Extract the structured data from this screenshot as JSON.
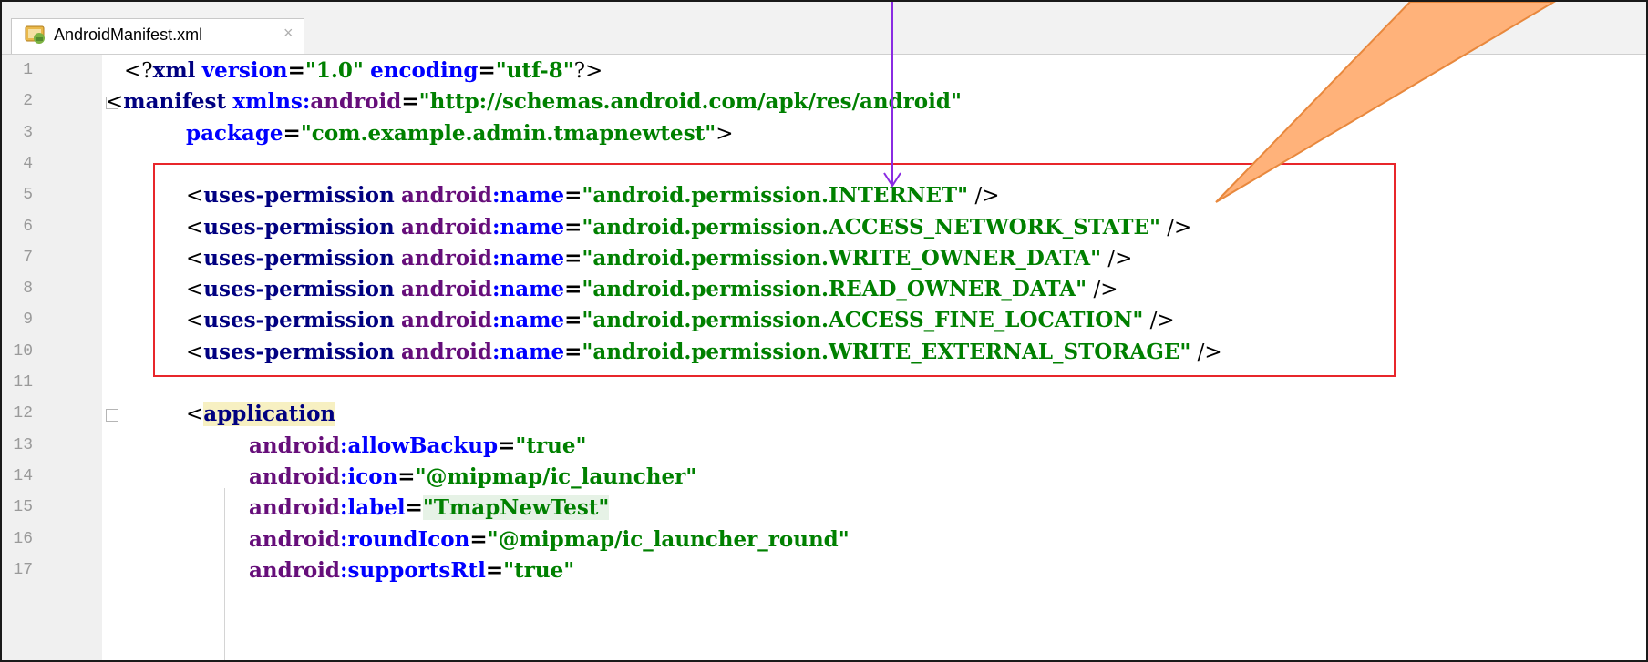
{
  "tab": {
    "filename": "AndroidManifest.xml",
    "close_glyph": "×",
    "icon": "android-xml-file-icon"
  },
  "editor": {
    "lines": [
      {
        "n": "1",
        "tokens": [
          {
            "t": "<?",
            "c": "t-punct"
          },
          {
            "t": "xml",
            "c": "t-tag"
          },
          {
            "t": " ",
            "c": "t-punct"
          },
          {
            "t": "version",
            "c": "t-attr"
          },
          {
            "t": "=",
            "c": "t-punct-b"
          },
          {
            "t": "\"1.0\"",
            "c": "t-val"
          },
          {
            "t": " ",
            "c": "t-punct"
          },
          {
            "t": "encoding",
            "c": "t-attr"
          },
          {
            "t": "=",
            "c": "t-punct-b"
          },
          {
            "t": "\"utf-8\"",
            "c": "t-val"
          },
          {
            "t": "?>",
            "c": "t-punct"
          }
        ]
      },
      {
        "n": "2",
        "fold": true,
        "tokens": [
          {
            "t": "<",
            "c": "t-punct"
          },
          {
            "t": "manifest",
            "c": "t-tag"
          },
          {
            "t": " ",
            "c": "t-punct"
          },
          {
            "t": "xmlns:",
            "c": "t-attr"
          },
          {
            "t": "android",
            "c": "t-ns"
          },
          {
            "t": "=",
            "c": "t-punct-b"
          },
          {
            "t": "\"http://schemas.android.com/apk/res/android\"",
            "c": "t-val"
          }
        ]
      },
      {
        "n": "3",
        "tokens": [
          {
            "t": "package",
            "c": "t-attr"
          },
          {
            "t": "=",
            "c": "t-punct-b"
          },
          {
            "t": "\"com.example.admin.tmapnewtest\"",
            "c": "t-val"
          },
          {
            "t": ">",
            "c": "t-punct"
          }
        ]
      },
      {
        "n": "4",
        "tokens": []
      },
      {
        "n": "5",
        "tokens": [
          {
            "t": "<",
            "c": "t-punct"
          },
          {
            "t": "uses-permission",
            "c": "t-tag"
          },
          {
            "t": " ",
            "c": "t-punct"
          },
          {
            "t": "android",
            "c": "t-ns"
          },
          {
            "t": ":name",
            "c": "t-attr"
          },
          {
            "t": "=",
            "c": "t-punct-b"
          },
          {
            "t": "\"android.permission.INTERNET\"",
            "c": "t-val"
          },
          {
            "t": " />",
            "c": "t-punct"
          }
        ]
      },
      {
        "n": "6",
        "tokens": [
          {
            "t": "<",
            "c": "t-punct"
          },
          {
            "t": "uses-permission",
            "c": "t-tag"
          },
          {
            "t": " ",
            "c": "t-punct"
          },
          {
            "t": "android",
            "c": "t-ns"
          },
          {
            "t": ":name",
            "c": "t-attr"
          },
          {
            "t": "=",
            "c": "t-punct-b"
          },
          {
            "t": "\"android.permission.ACCESS_NETWORK_STATE\"",
            "c": "t-val"
          },
          {
            "t": " />",
            "c": "t-punct"
          }
        ]
      },
      {
        "n": "7",
        "tokens": [
          {
            "t": "<",
            "c": "t-punct"
          },
          {
            "t": "uses-permission",
            "c": "t-tag"
          },
          {
            "t": " ",
            "c": "t-punct"
          },
          {
            "t": "android",
            "c": "t-ns"
          },
          {
            "t": ":name",
            "c": "t-attr"
          },
          {
            "t": "=",
            "c": "t-punct-b"
          },
          {
            "t": "\"android.permission.WRITE_OWNER_DATA\"",
            "c": "t-val"
          },
          {
            "t": " />",
            "c": "t-punct"
          }
        ]
      },
      {
        "n": "8",
        "tokens": [
          {
            "t": "<",
            "c": "t-punct"
          },
          {
            "t": "uses-permission",
            "c": "t-tag"
          },
          {
            "t": " ",
            "c": "t-punct"
          },
          {
            "t": "android",
            "c": "t-ns"
          },
          {
            "t": ":name",
            "c": "t-attr"
          },
          {
            "t": "=",
            "c": "t-punct-b"
          },
          {
            "t": "\"android.permission.READ_OWNER_DATA\"",
            "c": "t-val"
          },
          {
            "t": " />",
            "c": "t-punct"
          }
        ]
      },
      {
        "n": "9",
        "tokens": [
          {
            "t": "<",
            "c": "t-punct"
          },
          {
            "t": "uses-permission",
            "c": "t-tag"
          },
          {
            "t": " ",
            "c": "t-punct"
          },
          {
            "t": "android",
            "c": "t-ns"
          },
          {
            "t": ":name",
            "c": "t-attr"
          },
          {
            "t": "=",
            "c": "t-punct-b"
          },
          {
            "t": "\"android.permission.ACCESS_FINE_LOCATION\"",
            "c": "t-val"
          },
          {
            "t": " />",
            "c": "t-punct"
          }
        ]
      },
      {
        "n": "10",
        "tokens": [
          {
            "t": "<",
            "c": "t-punct"
          },
          {
            "t": "uses-permission",
            "c": "t-tag"
          },
          {
            "t": " ",
            "c": "t-punct"
          },
          {
            "t": "android",
            "c": "t-ns"
          },
          {
            "t": ":name",
            "c": "t-attr"
          },
          {
            "t": "=",
            "c": "t-punct-b"
          },
          {
            "t": "\"android.permission.WRITE_EXTERNAL_STORAGE\"",
            "c": "t-val"
          },
          {
            "t": " />",
            "c": "t-punct"
          }
        ]
      },
      {
        "n": "11",
        "tokens": []
      },
      {
        "n": "12",
        "fold": true,
        "tokens": [
          {
            "t": "<",
            "c": "t-punct"
          },
          {
            "t": "application",
            "c": "t-tag hl-app"
          }
        ]
      },
      {
        "n": "13",
        "tokens": [
          {
            "t": "android",
            "c": "t-ns"
          },
          {
            "t": ":allowBackup",
            "c": "t-attr"
          },
          {
            "t": "=",
            "c": "t-punct-b"
          },
          {
            "t": "\"true\"",
            "c": "t-val"
          }
        ]
      },
      {
        "n": "14",
        "tokens": [
          {
            "t": "android",
            "c": "t-ns"
          },
          {
            "t": ":icon",
            "c": "t-attr"
          },
          {
            "t": "=",
            "c": "t-punct-b"
          },
          {
            "t": "\"@mipmap/ic_launcher\"",
            "c": "t-val"
          }
        ]
      },
      {
        "n": "15",
        "tokens": [
          {
            "t": "android",
            "c": "t-ns"
          },
          {
            "t": ":label",
            "c": "t-attr"
          },
          {
            "t": "=",
            "c": "t-punct-b"
          },
          {
            "t": "\"TmapNewTest\"",
            "c": "t-val hl-label"
          }
        ]
      },
      {
        "n": "16",
        "tokens": [
          {
            "t": "android",
            "c": "t-ns"
          },
          {
            "t": ":roundIcon",
            "c": "t-attr"
          },
          {
            "t": "=",
            "c": "t-punct-b"
          },
          {
            "t": "\"@mipmap/ic_launcher_round\"",
            "c": "t-val"
          }
        ]
      },
      {
        "n": "17",
        "tokens": [
          {
            "t": "android",
            "c": "t-ns"
          },
          {
            "t": ":supportsRtl",
            "c": "t-attr"
          },
          {
            "t": "=",
            "c": "t-punct-b"
          },
          {
            "t": "\"true\"",
            "c": "t-val"
          }
        ]
      }
    ]
  },
  "annotations": {
    "highlight_box": {
      "color": "#e8262b"
    },
    "thin_arrow": {
      "color": "#8a2be2"
    },
    "callout": {
      "fill": "#ffb27a",
      "stroke": "#e8883d"
    }
  }
}
